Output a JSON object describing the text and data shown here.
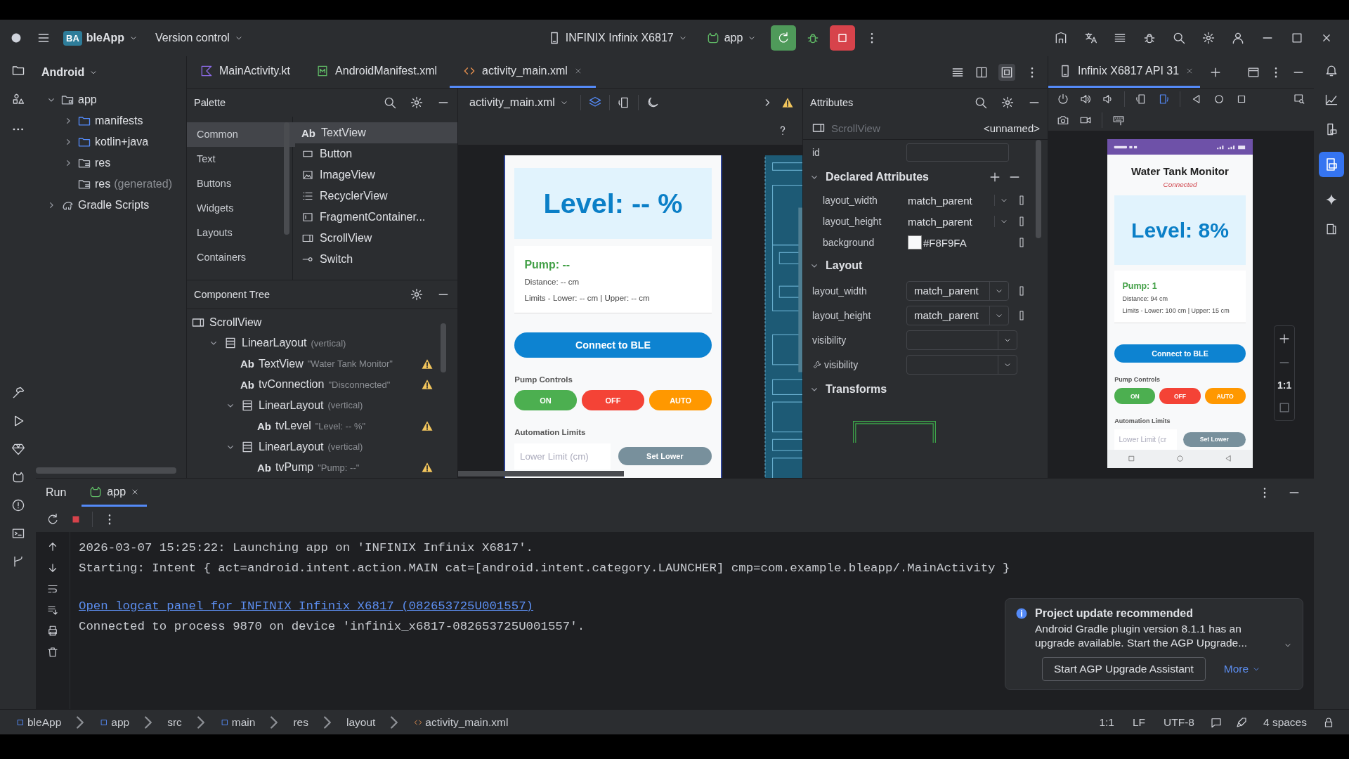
{
  "title_bar": {
    "project_badge": "BA",
    "project": "bleApp",
    "vcs": "Version control",
    "device": "INFINIX Infinix X6817",
    "run_config": "app"
  },
  "project_panel": {
    "view": "Android",
    "tree": [
      {
        "label": "app",
        "kind": "module",
        "expanded": true,
        "children": [
          {
            "label": "manifests",
            "kind": "folder",
            "expanded": false
          },
          {
            "label": "kotlin+java",
            "kind": "folder",
            "expanded": false
          },
          {
            "label": "res",
            "kind": "res",
            "expanded": false
          },
          {
            "label": "res",
            "note": "(generated)",
            "kind": "res"
          }
        ]
      },
      {
        "label": "Gradle Scripts",
        "kind": "gradle",
        "expanded": false
      }
    ]
  },
  "editor_tabs": [
    {
      "label": "MainActivity.kt",
      "kind": "kotlin",
      "selected": false
    },
    {
      "label": "AndroidManifest.xml",
      "kind": "manifest",
      "selected": false
    },
    {
      "label": "activity_main.xml",
      "kind": "layout",
      "selected": true
    }
  ],
  "palette": {
    "title": "Palette",
    "categories": [
      {
        "label": "Common",
        "selected": true
      },
      {
        "label": "Text",
        "selected": false
      },
      {
        "label": "Buttons",
        "selected": false
      },
      {
        "label": "Widgets",
        "selected": false
      },
      {
        "label": "Layouts",
        "selected": false
      },
      {
        "label": "Containers",
        "selected": false
      }
    ],
    "items": [
      {
        "badge": "Ab",
        "label": "TextView",
        "kind": "text",
        "selected": true
      },
      {
        "label": "Button",
        "kind": "button",
        "selected": false
      },
      {
        "label": "ImageView",
        "kind": "image",
        "selected": false
      },
      {
        "label": "RecyclerView",
        "kind": "list",
        "selected": false
      },
      {
        "label": "FragmentContainer...",
        "kind": "fragment",
        "selected": false
      },
      {
        "label": "ScrollView",
        "kind": "scroll",
        "selected": false
      },
      {
        "label": "Switch",
        "kind": "switch",
        "selected": false
      }
    ]
  },
  "component_tree": {
    "title": "Component Tree",
    "nodes": [
      {
        "label": "ScrollView",
        "kind": "scroll",
        "children": [
          {
            "label": "LinearLayout",
            "detail": "(vertical)",
            "kind": "linear",
            "expanded": true,
            "children": [
              {
                "badge": "Ab",
                "label": "TextView",
                "detail": "\"Water Tank Monitor\"",
                "kind": "text",
                "warning": true
              },
              {
                "badge": "Ab",
                "label": "tvConnection",
                "detail": "\"Disconnected\"",
                "kind": "text",
                "warning": true
              },
              {
                "label": "LinearLayout",
                "detail": "(vertical)",
                "kind": "linear",
                "expanded": true,
                "children": [
                  {
                    "badge": "Ab",
                    "label": "tvLevel",
                    "detail": "\"Level: -- %\"",
                    "kind": "text",
                    "warning": true
                  }
                ]
              },
              {
                "label": "LinearLayout",
                "detail": "(vertical)",
                "kind": "linear",
                "expanded": true,
                "children": [
                  {
                    "badge": "Ab",
                    "label": "tvPump",
                    "detail": "\"Pump: --\"",
                    "kind": "text",
                    "warning": true
                  }
                ]
              }
            ]
          }
        ]
      }
    ]
  },
  "design": {
    "file": "activity_main.xml",
    "preview": {
      "level": "Level: -- %",
      "pump": "Pump: --",
      "distance": "Distance: -- cm",
      "limits": "Limits - Lower: -- cm | Upper: -- cm",
      "connect_button": "Connect to BLE",
      "controls_label": "Pump Controls",
      "controls": [
        {
          "label": "ON",
          "color": "#4caf50"
        },
        {
          "label": "OFF",
          "color": "#f44336"
        },
        {
          "label": "AUTO",
          "color": "#ff9800"
        }
      ],
      "limits_label": "Automation Limits",
      "limit_field": {
        "placeholder": "Lower Limit (cm)"
      },
      "set_button": "Set Lower"
    }
  },
  "attributes": {
    "title": "Attributes",
    "component": "ScrollView",
    "component_name": "<unnamed>",
    "id_label": "id",
    "sections": [
      {
        "title": "Declared Attributes",
        "expanded": true,
        "rows": [
          {
            "name": "layout_width",
            "value": "match_parent",
            "kind": "dropdown"
          },
          {
            "name": "layout_height",
            "value": "match_parent",
            "kind": "dropdown"
          },
          {
            "name": "background",
            "value": "#F8F9FA",
            "kind": "color"
          }
        ]
      },
      {
        "title": "Layout",
        "expanded": true,
        "rows": [
          {
            "name": "layout_width",
            "value": "match_parent",
            "kind": "combo"
          },
          {
            "name": "layout_height",
            "value": "match_parent",
            "kind": "combo"
          },
          {
            "name": "visibility",
            "kind": "combo"
          },
          {
            "name": "visibility",
            "kind": "tool-combo"
          }
        ]
      },
      {
        "title": "Transforms",
        "expanded": true
      }
    ]
  },
  "running_device": {
    "tab": "Infinix X6817 API 31",
    "zoom_reset": "1:1",
    "phone": {
      "title": "Water Tank Monitor",
      "connection": "Connected",
      "level": "Level: 8%",
      "pump": "Pump: 1",
      "distance": "Distance: 94 cm",
      "limits": "Limits - Lower: 100 cm | Upper: 15 cm",
      "connect_button": "Connect to BLE",
      "controls_label": "Pump Controls",
      "controls": [
        {
          "label": "ON",
          "color": "#4caf50"
        },
        {
          "label": "OFF",
          "color": "#f44336"
        },
        {
          "label": "AUTO",
          "color": "#ff9800"
        }
      ],
      "limits_label": "Automation Limits",
      "limit_field": {
        "placeholder": "Lower Limit (cr"
      },
      "set_button": "Set Lower"
    }
  },
  "run_panel": {
    "title": "Run",
    "tab": "app",
    "lines": [
      {
        "text": "2026-03-07 15:25:22: Launching app on 'INFINIX Infinix X6817'.",
        "kind": "plain"
      },
      {
        "text": "Starting: Intent { act=android.intent.action.MAIN cat=[android.intent.category.LAUNCHER] cmp=com.example.bleapp/.MainActivity }",
        "kind": "plain"
      },
      {
        "text": "Open logcat panel for INFINIX Infinix X6817 (082653725U001557)",
        "kind": "link"
      },
      {
        "text": "Connected to process 9870 on device 'infinix_x6817-082653725U001557'.",
        "kind": "plain"
      }
    ]
  },
  "notification": {
    "title": "Project update recommended",
    "body": "Android Gradle plugin version 8.1.1 has an upgrade available. Start the AGP Upgrade...",
    "button": "Start AGP Upgrade Assistant",
    "more": "More"
  },
  "status_bar": {
    "breadcrumbs": [
      {
        "label": "bleApp",
        "kind": "module"
      },
      {
        "label": "app",
        "kind": "module"
      },
      {
        "label": "src",
        "kind": "dir"
      },
      {
        "label": "main",
        "kind": "module"
      },
      {
        "label": "res",
        "kind": "dir"
      },
      {
        "label": "layout",
        "kind": "dir"
      },
      {
        "label": "activity_main.xml",
        "kind": "layout"
      }
    ],
    "position": "1:1",
    "line_separator": "LF",
    "encoding": "UTF-8",
    "indent": "4 spaces"
  }
}
